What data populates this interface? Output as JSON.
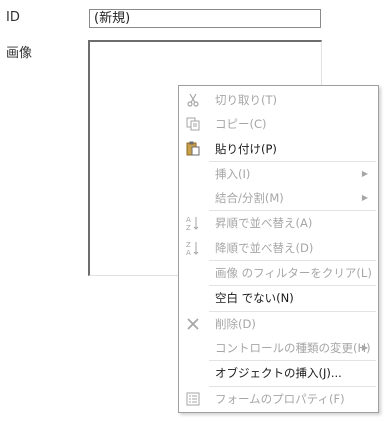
{
  "form": {
    "id_label": "ID",
    "id_value": "(新規)",
    "image_label": "画像"
  },
  "menu": {
    "cut": "切り取り(T)",
    "copy": "コピー(C)",
    "paste": "貼り付け(P)",
    "insert": "挿入(I)",
    "merge_split": "結合/分割(M)",
    "sort_asc": "昇順で並べ替え(A)",
    "sort_desc": "降順で並べ替え(D)",
    "clear_filter": "画像 のフィルターをクリア(L)",
    "not_blank": "空白 でない(N)",
    "delete": "削除(D)",
    "change_control_type": "コントロールの種類の変更(H)",
    "insert_object": "オブジェクトの挿入(J)...",
    "form_properties": "フォームのプロパティ(F)"
  }
}
